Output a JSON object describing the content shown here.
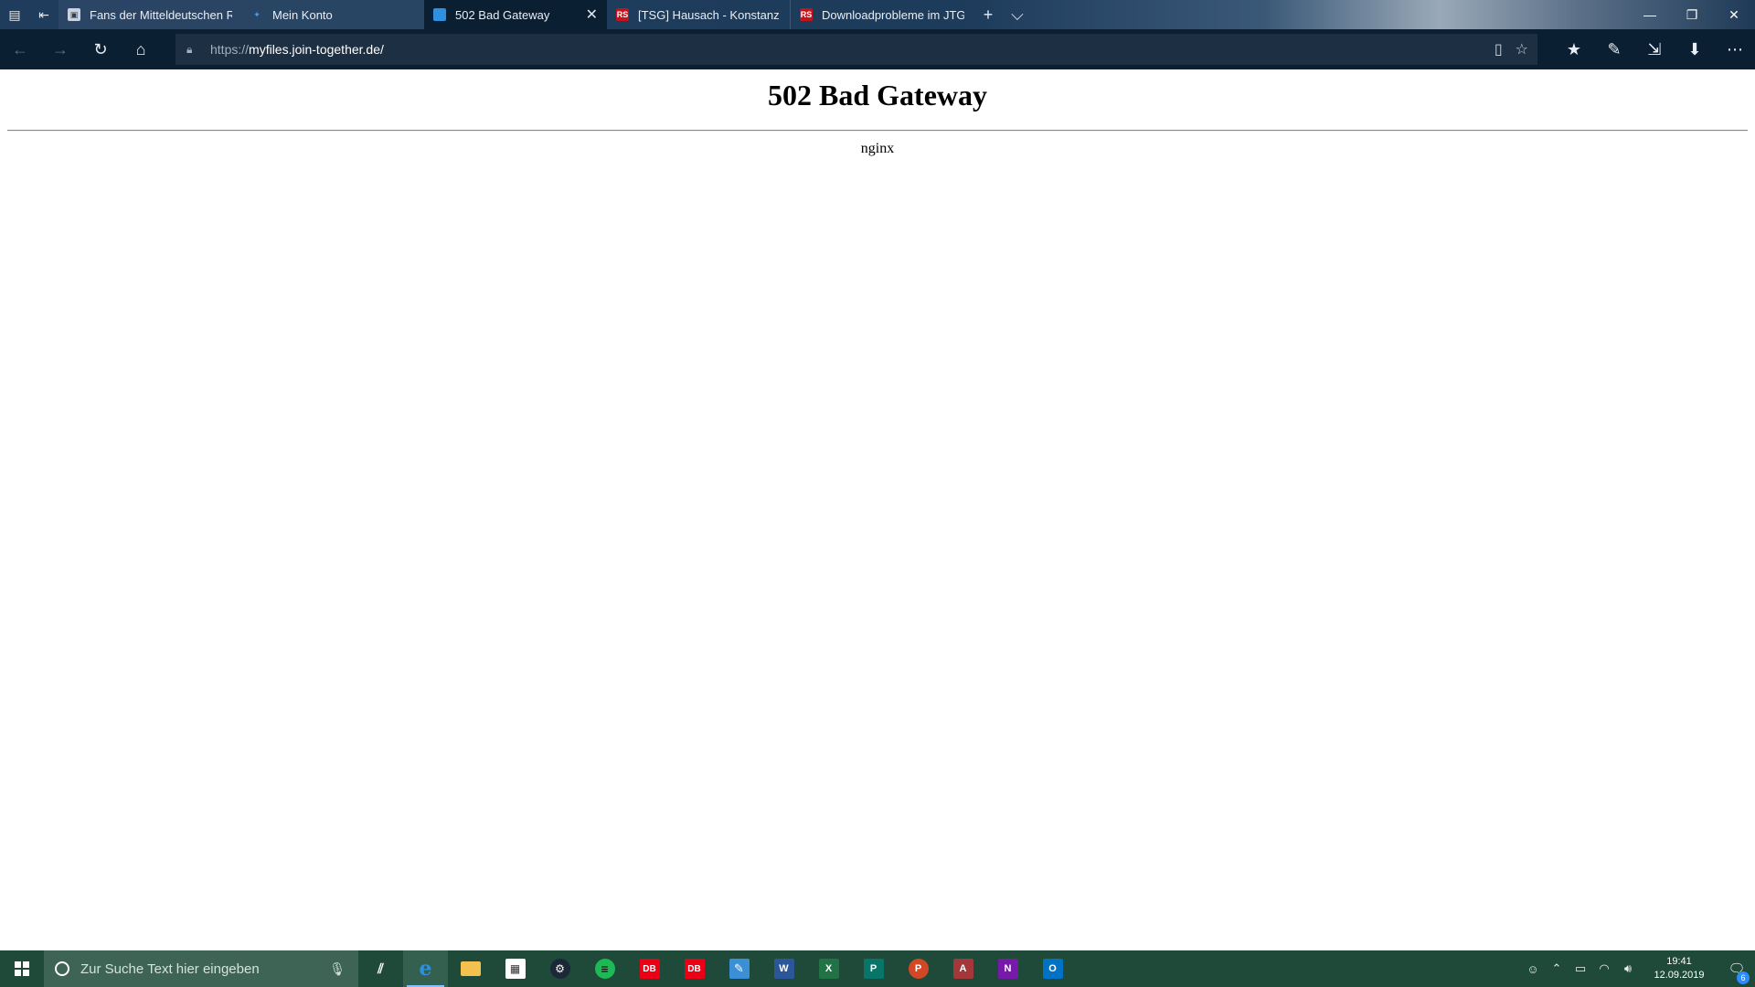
{
  "browser": {
    "tabs": [
      {
        "label": "Fans der Mitteldeutschen Re",
        "favicon": "page-icon"
      },
      {
        "label": "Mein Konto",
        "favicon": "konto-icon"
      },
      {
        "label": "502 Bad Gateway",
        "favicon": "globe-icon",
        "active": true
      },
      {
        "label": "[TSG] Hausach - Konstanz (S",
        "favicon": "rs-icon"
      },
      {
        "label": "Downloadprobleme im JTG",
        "favicon": "rs-icon"
      }
    ],
    "rs_favicon_text": "RS",
    "address": {
      "protocol": "https://",
      "host": "myfiles.join-together.de/"
    }
  },
  "page": {
    "heading": "502 Bad Gateway",
    "server": "nginx"
  },
  "taskbar": {
    "search_placeholder": "Zur Suche Text hier eingeben",
    "apps": [
      {
        "name": "task-view",
        "color": "#ffffff"
      },
      {
        "name": "edge",
        "color": "#2f8fe0",
        "active": true,
        "label": "e"
      },
      {
        "name": "file-explorer",
        "color": "#f2c14e"
      },
      {
        "name": "store",
        "color": "#ffffff"
      },
      {
        "name": "steam",
        "color": "#1b2838"
      },
      {
        "name": "spotify",
        "color": "#1db954"
      },
      {
        "name": "db-navigator",
        "color": "#ec0016",
        "label": "DB"
      },
      {
        "name": "db-app",
        "color": "#ec0016",
        "label": "DB"
      },
      {
        "name": "sketch-app",
        "color": "#3a8fd6"
      },
      {
        "name": "word",
        "color": "#2b579a",
        "label": "W"
      },
      {
        "name": "excel",
        "color": "#217346",
        "label": "X"
      },
      {
        "name": "publisher",
        "color": "#077568",
        "label": "P"
      },
      {
        "name": "powerpoint",
        "color": "#d24726",
        "label": "P"
      },
      {
        "name": "access",
        "color": "#a4373a",
        "label": "A"
      },
      {
        "name": "onenote",
        "color": "#7719aa",
        "label": "N"
      },
      {
        "name": "outlook",
        "color": "#0072c6",
        "label": "O"
      }
    ],
    "clock": {
      "time": "19:41",
      "date": "12.09.2019"
    },
    "notification_count": "6"
  }
}
